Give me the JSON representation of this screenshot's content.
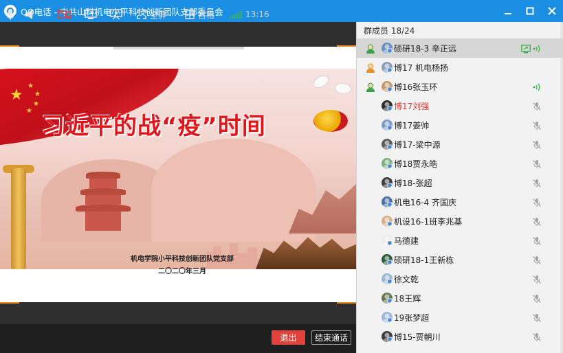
{
  "window": {
    "title": "QQ电话 - 中共山科机电小平科技创新团队支部委员会",
    "minimize": "–",
    "maximize": "□",
    "close": "✕"
  },
  "slide": {
    "headline": "习近平的战“疫”时间",
    "org": "机电学院小平科技创新团队党支部",
    "date": "二〇二〇年三月"
  },
  "toolbar": {
    "fullscreen_label": "全屏",
    "grid_label": "宫格",
    "time": "13:16",
    "exit_label": "退出",
    "end_call_label": "结束通话"
  },
  "panel": {
    "header": "群成员 18/24",
    "members": [
      {
        "name": "硕研18-3 辛正远",
        "role": "admin",
        "mic": "on",
        "screen": true,
        "red": false,
        "selected": true
      },
      {
        "name": "博17 机电杨扬",
        "role": "owner",
        "mic": "none",
        "screen": false,
        "red": false,
        "selected": false
      },
      {
        "name": "博16张玉环",
        "role": "admin",
        "mic": "on",
        "screen": false,
        "red": false,
        "selected": false
      },
      {
        "name": "博17刘强",
        "role": "none",
        "mic": "muted",
        "screen": false,
        "red": true,
        "selected": false
      },
      {
        "name": "博17姜帅",
        "role": "none",
        "mic": "muted",
        "screen": false,
        "red": false,
        "selected": false
      },
      {
        "name": "博17-梁中源",
        "role": "none",
        "mic": "muted",
        "screen": false,
        "red": false,
        "selected": false
      },
      {
        "name": "博18贾永皓",
        "role": "none",
        "mic": "muted",
        "screen": false,
        "red": false,
        "selected": false
      },
      {
        "name": "博18-张超",
        "role": "none",
        "mic": "muted",
        "screen": false,
        "red": false,
        "selected": false
      },
      {
        "name": "机电16-4 齐国庆",
        "role": "none",
        "mic": "muted",
        "screen": false,
        "red": false,
        "selected": false
      },
      {
        "name": "机设16-1班李兆基",
        "role": "none",
        "mic": "muted",
        "screen": false,
        "red": false,
        "selected": false
      },
      {
        "name": "马德建",
        "role": "none",
        "mic": "muted",
        "screen": false,
        "red": false,
        "selected": false
      },
      {
        "name": "硕研18-1王新栋",
        "role": "none",
        "mic": "muted",
        "screen": false,
        "red": false,
        "selected": false
      },
      {
        "name": "徐文乾",
        "role": "none",
        "mic": "muted",
        "screen": false,
        "red": false,
        "selected": false
      },
      {
        "name": "18王辉",
        "role": "none",
        "mic": "muted",
        "screen": false,
        "red": false,
        "selected": false
      },
      {
        "name": "19张梦超",
        "role": "none",
        "mic": "muted",
        "screen": false,
        "red": false,
        "selected": false
      },
      {
        "name": "博15-贾朝川",
        "role": "none",
        "mic": "muted",
        "screen": false,
        "red": false,
        "selected": false
      }
    ]
  },
  "colors": {
    "titlebar": "#1a8fe3",
    "accent_orange": "#f08a1c",
    "exit_red": "#e0433b",
    "mic_green": "#3bb54a",
    "muted_grey": "#a8a8a8"
  }
}
